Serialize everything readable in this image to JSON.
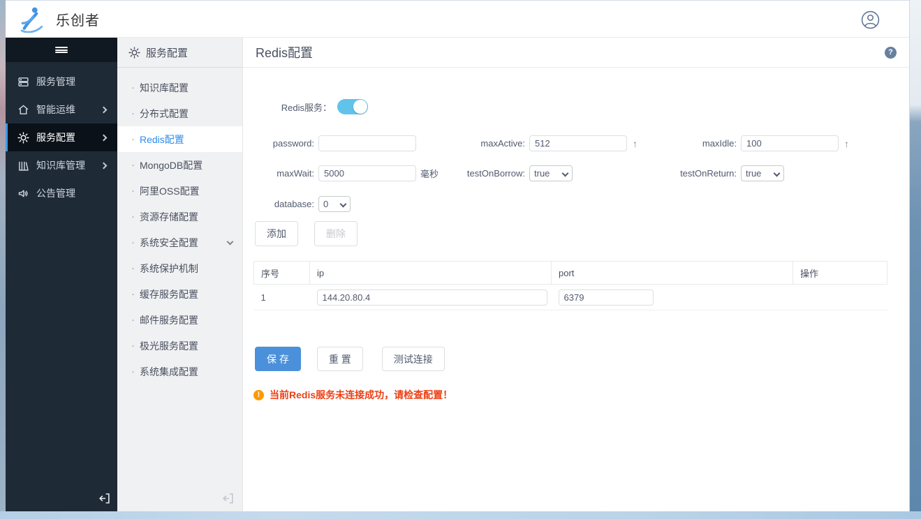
{
  "header": {
    "logo_text": "乐创者"
  },
  "sidebar": {
    "items": [
      {
        "label": "服务管理"
      },
      {
        "label": "智能运维"
      },
      {
        "label": "服务配置"
      },
      {
        "label": "知识库管理"
      },
      {
        "label": "公告管理"
      }
    ]
  },
  "submenu": {
    "title": "服务配置",
    "items": [
      {
        "label": "知识库配置"
      },
      {
        "label": "分布式配置"
      },
      {
        "label": "Redis配置"
      },
      {
        "label": "MongoDB配置"
      },
      {
        "label": "阿里OSS配置"
      },
      {
        "label": "资源存储配置"
      },
      {
        "label": "系统安全配置"
      },
      {
        "label": "系统保护机制"
      },
      {
        "label": "缓存服务配置"
      },
      {
        "label": "邮件服务配置"
      },
      {
        "label": "极光服务配置"
      },
      {
        "label": "系统集成配置"
      }
    ],
    "bullet": "·"
  },
  "content": {
    "title": "Redis配置",
    "help_glyph": "?",
    "form": {
      "service_label": "Redis服务：",
      "password_label": "password:",
      "password_value": "",
      "max_active_label": "maxActive:",
      "max_active_value": "512",
      "max_idle_label": "maxIdle:",
      "max_idle_value": "100",
      "max_wait_label": "maxWait:",
      "max_wait_value": "5000",
      "max_wait_unit": "毫秒",
      "test_on_borrow_label": "testOnBorrow:",
      "test_on_borrow_value": "true",
      "test_on_return_label": "testOnReturn:",
      "test_on_return_value": "true",
      "database_label": "database:",
      "database_value": "0",
      "stepper_glyph": "↑"
    },
    "toolbar": {
      "add_label": "添加",
      "delete_label": "删除"
    },
    "table": {
      "headers": [
        "序号",
        "ip",
        "port",
        "操作"
      ],
      "rows": [
        {
          "index": "1",
          "ip": "144.20.80.4",
          "port": "6379"
        }
      ]
    },
    "actions": {
      "save_label": "保 存",
      "reset_label": "重 置",
      "test_label": "测试连接"
    },
    "warning": {
      "icon_glyph": "!",
      "text": "当前Redis服务未连接成功，请检查配置！"
    }
  },
  "colors": {
    "accent_blue": "#2d8cf0",
    "save_blue": "#4b90da",
    "toggle_blue": "#62c3ea",
    "sidebar_dark": "#1f2a37",
    "warning_orange": "#ff9900",
    "error_red": "#ed3f14"
  }
}
